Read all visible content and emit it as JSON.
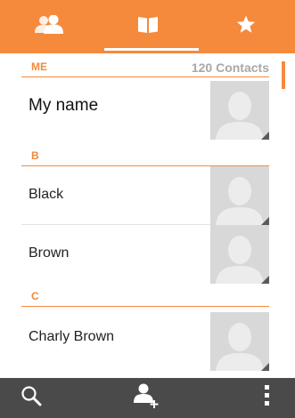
{
  "tabs": [
    {
      "name": "contacts-groups",
      "icon": "people-icon",
      "selected": false
    },
    {
      "name": "contacts-list",
      "icon": "book-icon",
      "selected": true
    },
    {
      "name": "favorites",
      "icon": "star-icon",
      "selected": false
    }
  ],
  "sections": {
    "me": {
      "letter": "ME",
      "count": "120 Contacts"
    },
    "b": {
      "letter": "B"
    },
    "c": {
      "letter": "C"
    }
  },
  "contacts": {
    "me": {
      "name": "My name"
    },
    "black": {
      "name": "Black"
    },
    "brown": {
      "name": "Brown"
    },
    "charly": {
      "name": "Charly Brown"
    }
  },
  "bottom_bar": {
    "icons": [
      "search-icon",
      "add-contact-icon",
      "overflow-menu-icon"
    ]
  },
  "colors": {
    "accent": "#f58a3c",
    "bottom_bar": "#4a4a4a",
    "avatar_bg": "#d8d8d8",
    "divider": "#e3e3e3"
  }
}
